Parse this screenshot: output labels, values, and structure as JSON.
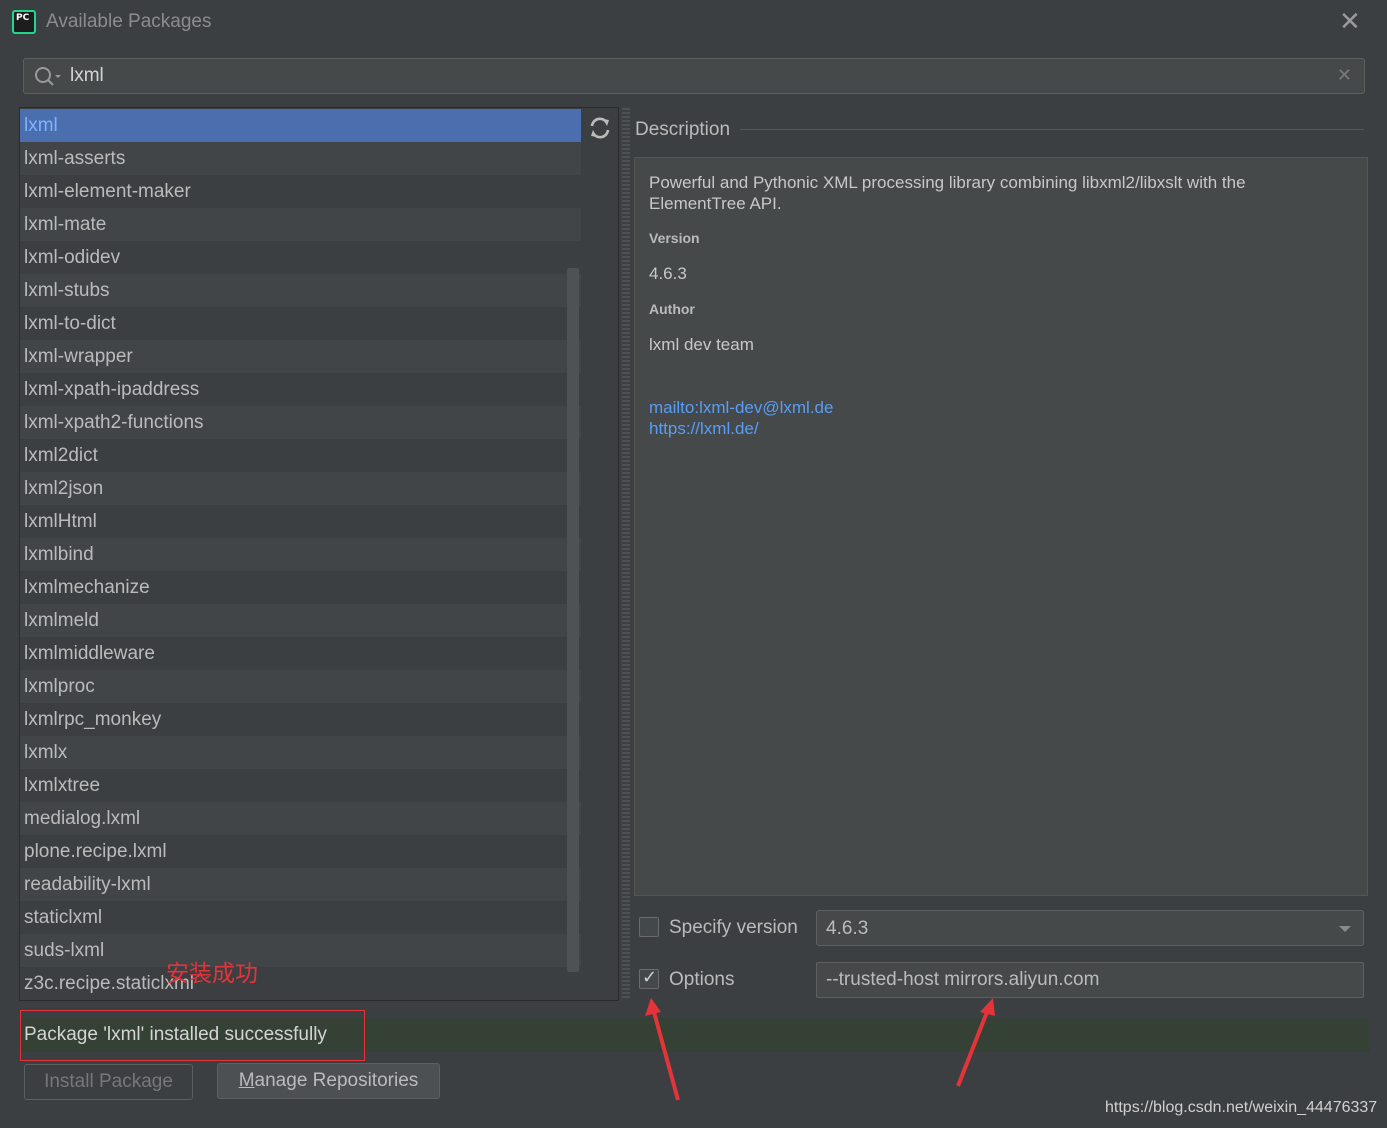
{
  "window": {
    "title": "Available Packages",
    "close_icon": "close-icon",
    "app_icon_text": "PC"
  },
  "search": {
    "value": "lxml",
    "icon": "search-icon",
    "clear_icon": "clear-icon"
  },
  "packages": [
    "lxml",
    "lxml-asserts",
    "lxml-element-maker",
    "lxml-mate",
    "lxml-odidev",
    "lxml-stubs",
    "lxml-to-dict",
    "lxml-wrapper",
    "lxml-xpath-ipaddress",
    "lxml-xpath2-functions",
    "lxml2dict",
    "lxml2json",
    "lxmlHtml",
    "lxmlbind",
    "lxmlmechanize",
    "lxmlmeld",
    "lxmlmiddleware",
    "lxmlproc",
    "lxmlrpc_monkey",
    "lxmlx",
    "lxmlxtree",
    "medialog.lxml",
    "plone.recipe.lxml",
    "readability-lxml",
    "staticlxml",
    "suds-lxml",
    "z3c.recipe.staticlxml"
  ],
  "selected_package": "lxml",
  "description": {
    "heading": "Description",
    "summary": "Powerful and Pythonic XML processing library combining libxml2/libxslt with the ElementTree API.",
    "version_label": "Version",
    "version_value": "4.6.3",
    "author_label": "Author",
    "author_value": "lxml dev team",
    "mail_link": "mailto:lxml-dev@lxml.de",
    "home_link": "https://lxml.de/"
  },
  "options": {
    "specify_version_label": "Specify version",
    "specify_version_checked": false,
    "version_selected": "4.6.3",
    "options_label": "Options",
    "options_checked": true,
    "options_value": "--trusted-host mirrors.aliyun.com"
  },
  "status": {
    "message": "Package 'lxml' installed successfully"
  },
  "buttons": {
    "install": "Install Package",
    "manage_prefix": "M",
    "manage_rest": "anage Repositories"
  },
  "annotation": "安装成功",
  "watermark": "https://blog.csdn.net/weixin_44476337",
  "colors": {
    "selection": "#4b6eaf",
    "link": "#589df6",
    "annotation_red": "#e5333a",
    "success_bar": "#344134"
  }
}
